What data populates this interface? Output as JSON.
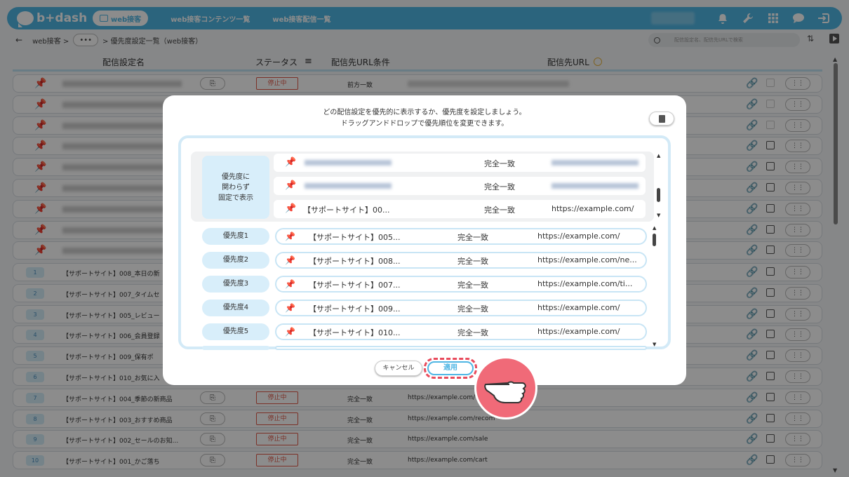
{
  "app": {
    "brand": "b+dash",
    "nav_active": "web接客",
    "nav_links": [
      "web接客コンテンツ一覧",
      "web接客配信一覧"
    ]
  },
  "breadcrumb": {
    "root": "web接客 >",
    "dots": "•••",
    "current": "> 優先度設定一覧（web接客）"
  },
  "search": {
    "placeholder": "配信設定名、配信先URLで検索"
  },
  "table": {
    "headers": {
      "name": "配信設定名",
      "status": "ステータス",
      "condition": "配信先URL条件",
      "url": "配信先URL"
    },
    "pinned_rows": [
      {
        "condition": "前方一致"
      },
      {},
      {},
      {},
      {},
      {},
      {},
      {},
      {}
    ],
    "rows": [
      {
        "num": "1",
        "name": "【サポートサイト】008_本日の新"
      },
      {
        "num": "2",
        "name": "【サポートサイト】007_タイムセ"
      },
      {
        "num": "3",
        "name": "【サポートサイト】005_レビュー"
      },
      {
        "num": "4",
        "name": "【サポートサイト】006_会員登録"
      },
      {
        "num": "5",
        "name": "【サポートサイト】009_保有ポ"
      },
      {
        "num": "6",
        "name": "【サポートサイト】010_お気に入"
      },
      {
        "num": "7",
        "name": "【サポートサイト】004_季節の新商品",
        "status": "停止中",
        "condition": "完全一致",
        "url": "https://example.com/"
      },
      {
        "num": "8",
        "name": "【サポートサイト】003_おすすめ商品",
        "status": "停止中",
        "condition": "完全一致",
        "url": "https://example.com/recom"
      },
      {
        "num": "9",
        "name": "【サポートサイト】002_セールのお知...",
        "status": "停止中",
        "condition": "完全一致",
        "url": "https://example.com/sale"
      },
      {
        "num": "10",
        "name": "【サポートサイト】001_かご落ち",
        "status": "停止中",
        "condition": "完全一致",
        "url": "https://example.com/cart"
      }
    ],
    "first_status": "停止中"
  },
  "modal": {
    "line1": "どの配信設定を優先的に表示するか、優先度を設定しましょう。",
    "line2": "ドラッグアンドドロップで優先順位を変更できます。",
    "fixed_label_1": "優先度に",
    "fixed_label_2": "関わらず",
    "fixed_label_3": "固定で表示",
    "fixed_items": [
      {
        "name": "",
        "condition": "完全一致",
        "url": ""
      },
      {
        "name": "",
        "condition": "完全一致",
        "url": ""
      },
      {
        "name": "【サポートサイト】00...",
        "condition": "完全一致",
        "url": "https://example.com/"
      }
    ],
    "priority_items": [
      {
        "label": "優先度1",
        "name": "【サポートサイト】005...",
        "condition": "完全一致",
        "url": "https://example.com/"
      },
      {
        "label": "優先度2",
        "name": "【サポートサイト】008...",
        "condition": "完全一致",
        "url": "https://example.com/ne..."
      },
      {
        "label": "優先度3",
        "name": "【サポートサイト】007...",
        "condition": "完全一致",
        "url": "https://example.com/ti..."
      },
      {
        "label": "優先度4",
        "name": "【サポートサイト】009...",
        "condition": "完全一致",
        "url": "https://example.com/"
      },
      {
        "label": "優先度5",
        "name": "【サポートサイト】010...",
        "condition": "完全一致",
        "url": "https://example.com/"
      }
    ],
    "cancel_label": "キャンセル",
    "apply_label": "適用"
  }
}
